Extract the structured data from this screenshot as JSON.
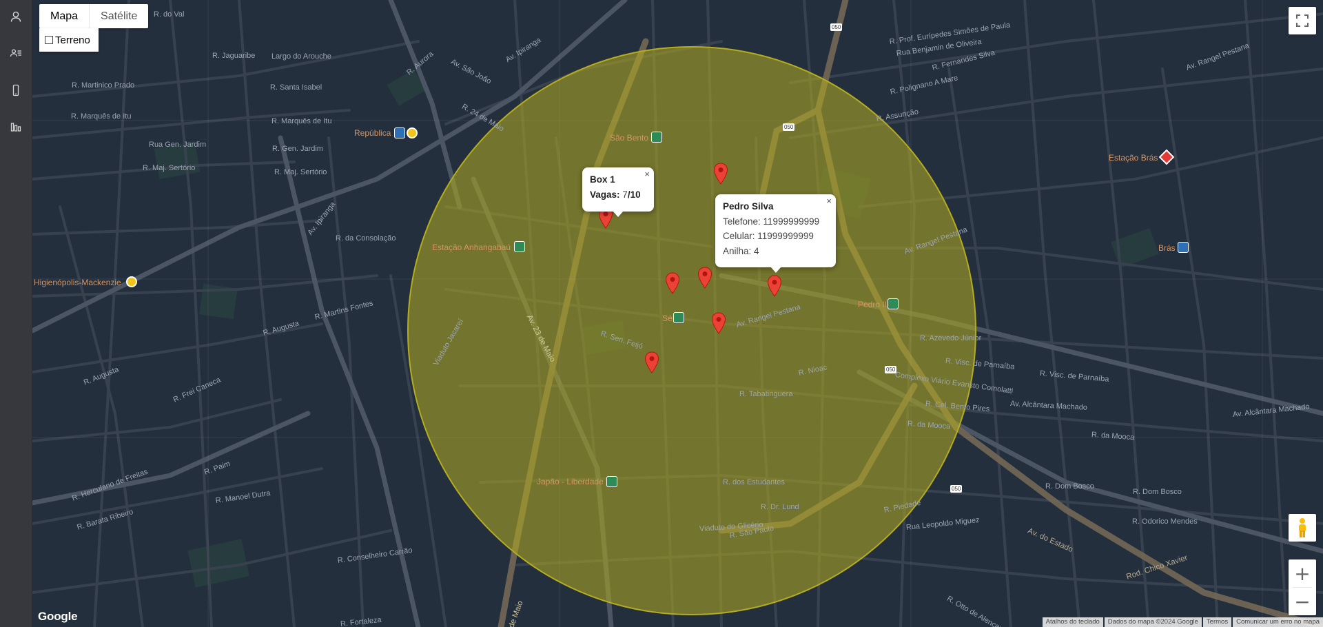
{
  "sidebar": {
    "items": [
      {
        "icon": "user-icon"
      },
      {
        "icon": "contacts-list-icon"
      },
      {
        "icon": "phone-icon"
      },
      {
        "icon": "chart-icon"
      }
    ]
  },
  "map_controls": {
    "map_type_active": "Mapa",
    "map_type_other": "Satélite",
    "terrain_label": "Terreno",
    "zoom_in": "+",
    "zoom_out": "−"
  },
  "footer": {
    "logo": "Google",
    "shortcuts": "Atalhos do teclado",
    "map_data": "Dados do mapa ©2024 Google",
    "terms": "Termos",
    "report": "Comunicar um erro no mapa"
  },
  "info_box": {
    "title": "Box 1",
    "vagas_label": "Vagas:",
    "vagas_used": "7",
    "vagas_sep": "/",
    "vagas_total": "10",
    "close": "×"
  },
  "info_person": {
    "name": "Pedro Silva",
    "phone": "Telefone: 11999999999",
    "mobile": "Celular: 11999999999",
    "ring": "Anilha: 4",
    "close": "×"
  },
  "labels": {
    "republica": "República",
    "sao_bento": "São Bento",
    "anhangabau": "Estação Anhangabaú",
    "higienopolis": "Higienópolis-Mackenzie",
    "estacao_bras": "Estação Brás",
    "bras": "Brás",
    "pedro_ii": "Pedro II",
    "se": "Sé",
    "japao": "Japão - Liberdade",
    "r_val": "R. do Val",
    "r_jaguaribe": "R. Jaguaribe",
    "largo_arouche": "Largo do Arouche",
    "r_martinico": "R. Martinico Prado",
    "r_santa_isabel": "R. Santa Isabel",
    "r_marques": "R. Marquês de Itu",
    "r_marques2": "R. Marquês de Itu",
    "r_gen_jardim": "Rua Gen. Jardim",
    "r_gen_jardim2": "R. Gen. Jardim",
    "r_maj_sertorio": "R. Maj. Sertório",
    "r_maj_sertorio2": "R. Maj. Sertório",
    "r_consolacao": "R. da Consolação",
    "r_martins_fontes": "R. Martins Fontes",
    "r_augusta": "R. Augusta",
    "r_augusta2": "R. Augusta",
    "r_frei_caneca": "R. Frei Caneca",
    "r_tabatinguera": "R. Tabatinguera",
    "r_estudantes": "R. dos Estudantes",
    "viaduto_glicerio": "Viaduto do Glicério",
    "r_sao_paulo": "R. São Paulo",
    "r_dr_lund": "R. Dr. Lund",
    "r_piedade": "R. Piedade",
    "rua_leopoldo": "Rua Leopoldo Miguez",
    "av_estado": "Av. do Estado",
    "rod_chico": "Rod. Chico Xavier",
    "av_alcantara": "Av. Alcântara Machado",
    "av_alcantara2": "Av. Alcântara Machado",
    "r_mooca": "R. da Mooca",
    "r_mooca2": "R. da Mooca",
    "r_bento_pires": "R. Cel. Bento Pires",
    "complexo": "Complexo Viário Evaristo Comolatti",
    "r_visc_parnaiba": "R. Visc. de Parnaíba",
    "r_visc_parnaiba2": "R. Visc. de Parnaíba",
    "r_azevedo": "R. Azevedo Júnior",
    "av_rangel": "Av. Rangel Pestana",
    "av_rangel2": "Av. Rangel Pestana",
    "av_rangel3": "Av. Rangel Pestana",
    "r_assuncao": "R. Assunção",
    "r_polignano": "R. Polignano A Mare",
    "r_fernandes": "R. Fernandes Silva",
    "r_prof_euripedes": "R. Prof. Eurípedes Simões de Paula",
    "r_benjamin": "Rua Benjamin de Oliveira",
    "av_ipiranga": "Av. Ipiranga",
    "av_ipiranga2": "Av. Ipiranga",
    "av_sao_joao": "Av. São João",
    "r_aurora": "R. Aurora",
    "r_24_maio": "R. 24 de Maio",
    "av_23_maio": "Av. 23 de Maio",
    "av_23_maio2": "de Maio",
    "viaduto_jacarei": "Viaduto Jacareí",
    "r_sen_feijo": "R. Sen. Feijó",
    "r_nioac": "R. Nioac",
    "r_dom_bosco": "R. Dom Bosco",
    "r_dom_bosco2": "R. Dom Bosco",
    "r_odorico": "R. Odorico Mendes",
    "r_paim": "R. Paim",
    "r_herculano": "R. Herculano de Freitas",
    "r_manoel_dutra": "R. Manoel Dutra",
    "r_barata": "R. Barata Ribeiro",
    "r_conselheiro_carrao": "R. Conselheiro Carrão",
    "r_otto": "R. Otto de Alencar",
    "r_fortaleza": "R. Fortaleza",
    "route_050a": "050",
    "route_050b": "050",
    "route_050c": "050",
    "route_050d": "050"
  },
  "colors": {
    "map_bg": "#242f3e",
    "road": "#38414e",
    "highway": "#746855",
    "circle_fill": "#b5ad1f",
    "marker": "#ea4335"
  }
}
